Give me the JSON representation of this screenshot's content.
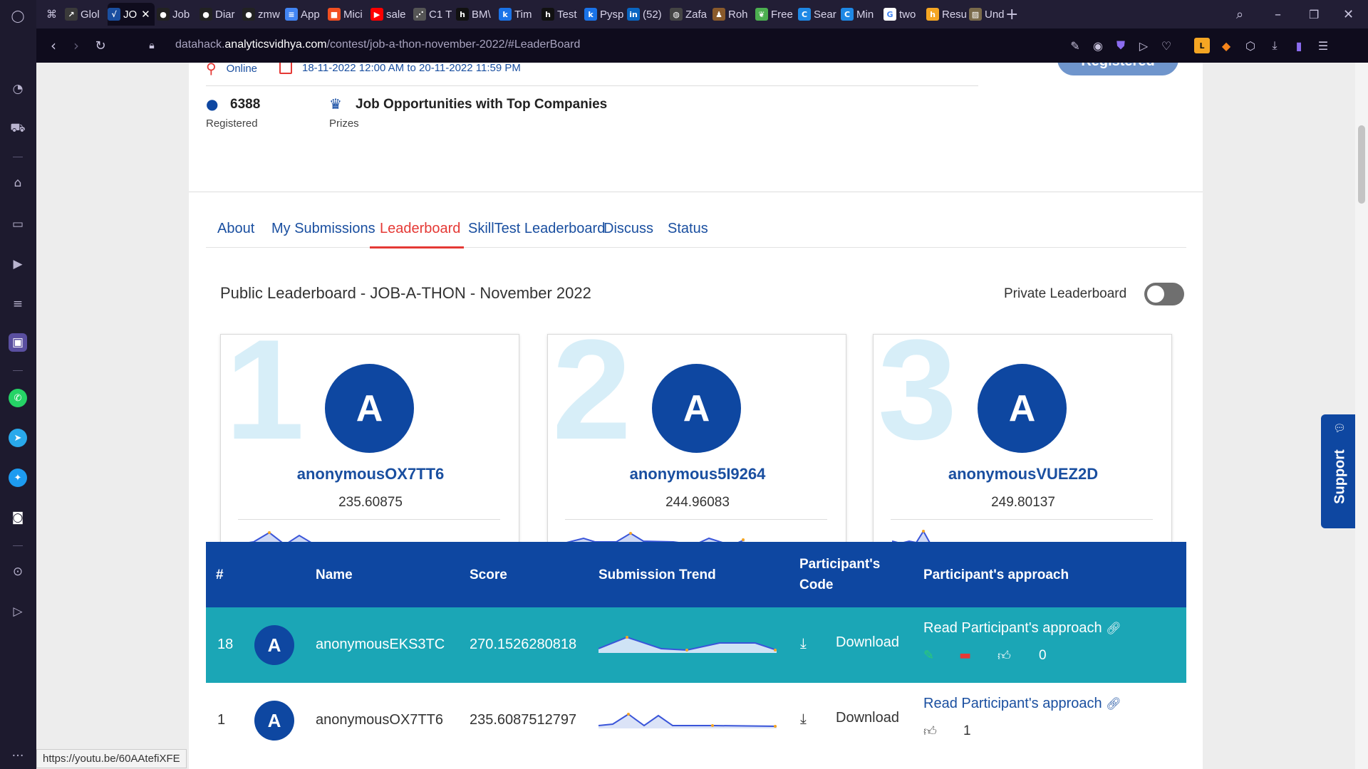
{
  "browser": {
    "tabs": [
      {
        "label": "Glol",
        "icon": "chart-icon",
        "color": "#3a3a3a"
      },
      {
        "label": "JO",
        "icon": "av-icon",
        "color": "#1a4fa0",
        "active": true
      },
      {
        "label": "Job",
        "icon": "github-icon",
        "color": "#222"
      },
      {
        "label": "Diar",
        "icon": "github-icon",
        "color": "#222"
      },
      {
        "label": "zmw",
        "icon": "github-icon",
        "color": "#222"
      },
      {
        "label": "App",
        "icon": "docs-icon",
        "color": "#4285f4"
      },
      {
        "label": "Mici",
        "icon": "microsoft-icon",
        "color": "#f25022"
      },
      {
        "label": "sale",
        "icon": "youtube-icon",
        "color": "#ff0000"
      },
      {
        "label": "C1 T",
        "icon": "dots-icon",
        "color": "#555"
      },
      {
        "label": "BM\\",
        "icon": "h-icon",
        "color": "#111"
      },
      {
        "label": "Tim",
        "icon": "k-icon",
        "color": "#1a73e8"
      },
      {
        "label": "Test",
        "icon": "h-icon",
        "color": "#111"
      },
      {
        "label": "Pysp",
        "icon": "k-icon",
        "color": "#1a73e8"
      },
      {
        "label": "(52)",
        "icon": "linkedin-icon",
        "color": "#0a66c2"
      },
      {
        "label": "Zafa",
        "icon": "globe-icon",
        "color": "#444"
      },
      {
        "label": "Roh",
        "icon": "person-icon",
        "color": "#8a5a2b"
      },
      {
        "label": "Free",
        "icon": "leaf-icon",
        "color": "#4caf50"
      },
      {
        "label": "Sear",
        "icon": "c-icon",
        "color": "#1e88e5"
      },
      {
        "label": "Min",
        "icon": "c-icon",
        "color": "#1e88e5"
      },
      {
        "label": "two",
        "icon": "google-icon",
        "color": "#fff"
      },
      {
        "label": "Resu",
        "icon": "h-icon",
        "color": "#f5a623"
      },
      {
        "label": "Und",
        "icon": "image-icon",
        "color": "#7a6a4a"
      }
    ],
    "url_prefix": "datahack.",
    "url_domain": "analyticsvidhya.com",
    "url_path": "/contest/job-a-thon-november-2022/#LeaderBoard",
    "status_url": "https://youtu.be/60AAtefiXFE"
  },
  "event": {
    "location": "Online",
    "dates": "18-11-2022 12:00 AM to 20-11-2022 11:59 PM",
    "registered_count": "6388",
    "registered_label": "Registered",
    "prize": "Job Opportunities with Top Companies",
    "prize_label": "Prizes",
    "registered_button": "Registered"
  },
  "tabs": [
    "About",
    "My Submissions",
    "Leaderboard",
    "SkillTest Leaderboard",
    "Discuss",
    "Status"
  ],
  "active_tab": "Leaderboard",
  "leaderboard": {
    "title": "Public Leaderboard - JOB-A-THON - November 2022",
    "private_toggle_label": "Private Leaderboard",
    "private_toggle_on": false,
    "podium": [
      {
        "rank": "1",
        "initial": "A",
        "name": "anonymousOX7TT6",
        "score": "235.60875"
      },
      {
        "rank": "2",
        "initial": "A",
        "name": "anonymous5I9264",
        "score": "244.96083"
      },
      {
        "rank": "3",
        "initial": "A",
        "name": "anonymousVUEZ2D",
        "score": "249.80137"
      }
    ],
    "columns": {
      "rank": "#",
      "name": "Name",
      "score": "Score",
      "trend": "Submission Trend",
      "code_line1": "Participant's",
      "code_line2": "Code",
      "approach": "Participant's approach"
    },
    "rows": [
      {
        "rank": "18",
        "initial": "A",
        "name": "anonymousEKS3TC",
        "score": "270.1526280818",
        "download": "Download",
        "approach_link": "Read Participant's approach",
        "likes": "0",
        "highlight": true
      },
      {
        "rank": "1",
        "initial": "A",
        "name": "anonymousOX7TT6",
        "score": "235.6087512797",
        "download": "Download",
        "approach_link": "Read Participant's approach",
        "likes": "1",
        "highlight": false
      }
    ]
  },
  "support_label": "Support",
  "colors": {
    "brand_blue": "#0e47a1",
    "accent_red": "#e53935",
    "highlight_row": "#1ba6b6"
  }
}
